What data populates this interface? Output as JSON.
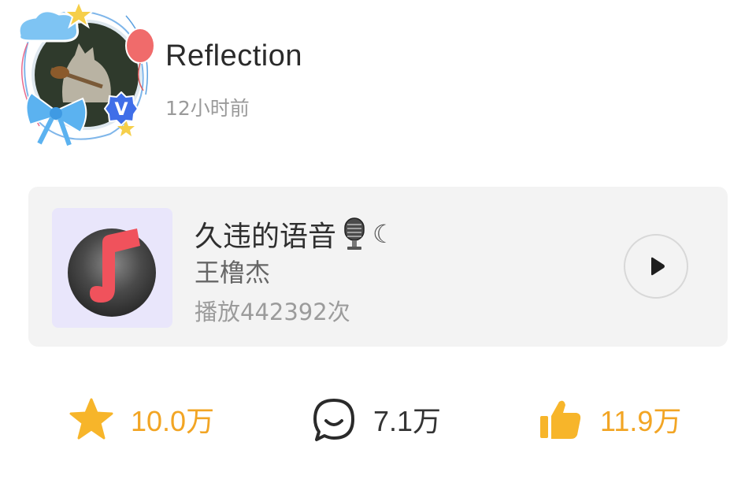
{
  "post": {
    "user_name": "Reflection",
    "time": "12小时前",
    "verified_badge": "V"
  },
  "music": {
    "title": "久违的语音",
    "title_emoji": "microphone-icon",
    "title_symbol": "☾",
    "artist": "王橹杰",
    "plays": "播放442392次",
    "cover_icon": "music-note-icon",
    "play_icon": "play-icon"
  },
  "actions": {
    "favorite": {
      "count": "10.0万",
      "icon": "star-icon"
    },
    "comment": {
      "count": "7.1万",
      "icon": "comment-icon"
    },
    "like": {
      "count": "11.9万",
      "icon": "thumbs-up-icon"
    }
  },
  "colors": {
    "accent": "#f2a524",
    "card_bg": "#f3f3f3",
    "cover_bg": "#e9e6fb",
    "note_red": "#f0525c",
    "badge_blue": "#3f6ee8"
  }
}
